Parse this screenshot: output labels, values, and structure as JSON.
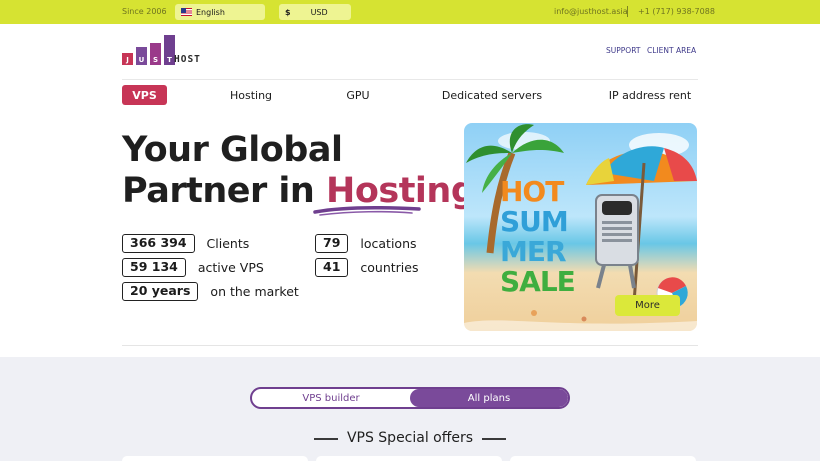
{
  "topbar": {
    "since": "Since 2006",
    "language": "English",
    "currency_symbol": "$",
    "currency": "USD",
    "email": "info@justhost.asia",
    "phone": "+1 (717) 938-7088"
  },
  "header": {
    "logo_letters": [
      "J",
      "U",
      "S",
      "T"
    ],
    "logo_word": "HOST",
    "support": "SUPPORT",
    "client_area": "CLIENT AREA"
  },
  "nav": {
    "items": [
      "VPS",
      "Hosting",
      "GPU",
      "Dedicated servers",
      "IP address rent"
    ],
    "active": "VPS"
  },
  "hero": {
    "title_line1": "Your Global",
    "title_line2_start": "Partner in ",
    "title_accent": "Hosting",
    "stats": [
      {
        "value": "366 394",
        "label": "Clients"
      },
      {
        "value": "59 134",
        "label": "active VPS"
      },
      {
        "value": "20 years",
        "label": "on the market"
      },
      {
        "value": "79",
        "label": "locations"
      },
      {
        "value": "41",
        "label": "countries"
      }
    ]
  },
  "promo": {
    "lines": [
      "HOT",
      "SUM",
      "MER",
      "SALE"
    ],
    "button": "More"
  },
  "plans": {
    "toggle": [
      "VPS builder",
      "All plans"
    ],
    "active": "All plans",
    "section_title": "VPS Special offers"
  },
  "colors": {
    "topbar": "#d6e332",
    "accent": "#c73556",
    "purple": "#7a4a9a",
    "lower_bg": "#eff0f5"
  }
}
